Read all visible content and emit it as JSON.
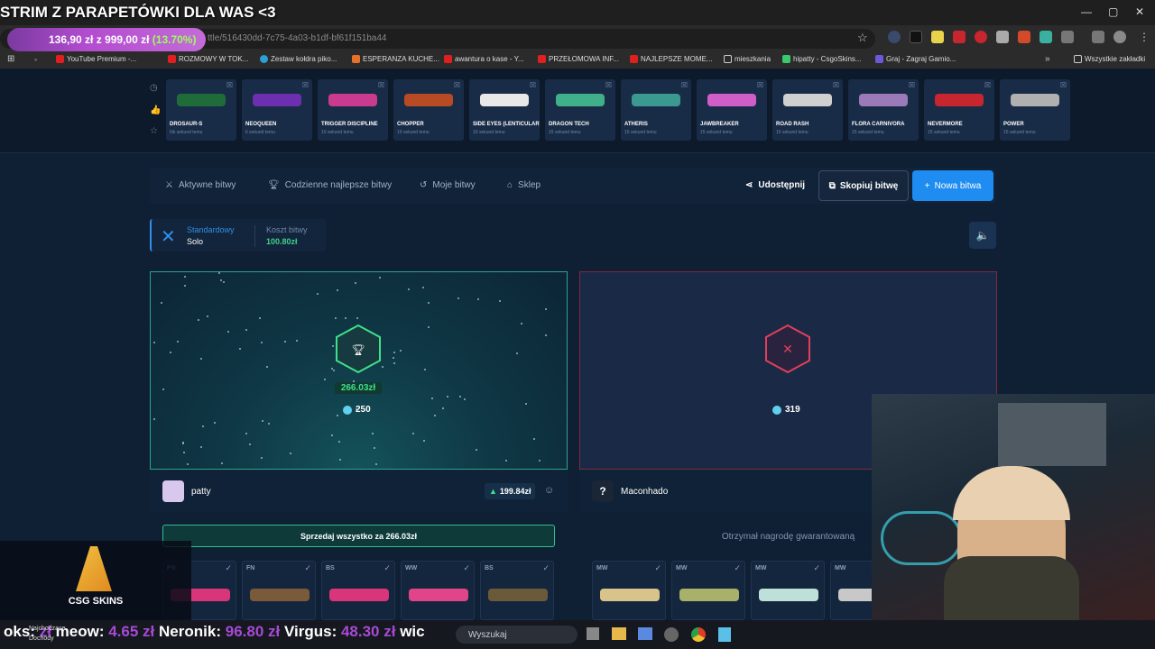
{
  "stream_title": "STRIM Z PARAPETÓWKI DLA WAS <3",
  "browser": {
    "price_main": "136,90 zł",
    "price_sep": "z",
    "price_goal": "999,00 zł",
    "price_pct": "(13.70%)",
    "url_fragment": "ttle/516430dd-7c75-4a03-b1df-bf61f151ba44",
    "bookmarks": [
      "YouTube Premium -...",
      "ROZMOWY W TOK...",
      "Zestaw kołdra piko...",
      "ESPERANZA KUCHE...",
      "awantura o kase - Y...",
      "PRZEŁOMOWA INF...",
      "NAJLEPSZE MOME...",
      "mieszkania",
      "hipatty - CsgoSkins...",
      "Graj - Zagraj Gamio..."
    ],
    "bookmarks_all": "Wszystkie zakładki"
  },
  "drops": [
    {
      "name": "DROSAUR-S",
      "sub": "6ik sekund temu",
      "color": "#1f6b3a"
    },
    {
      "name": "NEOQUEEN",
      "sub": "6 sekund temu",
      "color": "#6b2fb0"
    },
    {
      "name": "TRIGGER DISCIPLINE",
      "sub": "10 sekund temu",
      "color": "#c93b8f"
    },
    {
      "name": "CHOPPER",
      "sub": "10 sekund temu",
      "color": "#b84a24"
    },
    {
      "name": "SIDE EYES (LENTICULAR)",
      "sub": "10 sekund temu",
      "color": "#e8e8e8"
    },
    {
      "name": "DRAGON TECH",
      "sub": "15 sekund temu",
      "color": "#3fb08a"
    },
    {
      "name": "ATHERIS",
      "sub": "15 sekund temu",
      "color": "#3a9a8f"
    },
    {
      "name": "JAWBREAKER",
      "sub": "15 sekund temu",
      "color": "#cf5ec8"
    },
    {
      "name": "ROAD RASH",
      "sub": "15 sekund temu",
      "color": "#d0d0d0"
    },
    {
      "name": "FLORA CARNIVORA",
      "sub": "15 sekund temu",
      "color": "#9a7ab8"
    },
    {
      "name": "NEVERMORE",
      "sub": "15 sekund temu",
      "color": "#c8262e"
    },
    {
      "name": "POWER",
      "sub": "15 sekund temu",
      "color": "#b0b0b0"
    }
  ],
  "nav": {
    "active_battles": "Aktywne bitwy",
    "daily_best": "Codzienne najlepsze bitwy",
    "my_battles": "Moje bitwy",
    "shop": "Sklep",
    "share": "Udostępnij",
    "copy_battle": "Skopiuj bitwę",
    "new_battle": "Nowa bitwa"
  },
  "mode": {
    "type_label": "Standardowy",
    "type_value": "Solo",
    "cost_label": "Koszt bitwy",
    "cost_value": "100.80zł"
  },
  "left_player": {
    "win_amount": "266.03zł",
    "coins": "250",
    "name": "patty",
    "balance": "199.84zł",
    "sell_all": "Sprzedaj wszystko za 266.03zł",
    "items": [
      {
        "wear": "FN",
        "color": "#d8357a"
      },
      {
        "wear": "FN",
        "color": "#7a5a3a"
      },
      {
        "wear": "BS",
        "color": "#d8357a"
      },
      {
        "wear": "WW",
        "color": "#e0458a"
      },
      {
        "wear": "BS",
        "color": "#6a5a3a"
      }
    ]
  },
  "right_player": {
    "coins": "319",
    "name": "Maconhado",
    "guaranteed": "Otrzymał nagrodę gwarantowaną",
    "items": [
      {
        "wear": "MW",
        "color": "#d8c48a"
      },
      {
        "wear": "MW",
        "color": "#a8b06a"
      },
      {
        "wear": "MW",
        "color": "#bfe0d8"
      },
      {
        "wear": "MW",
        "color": "#c8c8c8"
      }
    ]
  },
  "overlay": {
    "logo": "CSG SKINS",
    "ticker": [
      {
        "name": "oks:",
        "value": ""
      },
      {
        "name": "",
        "value": "zł"
      },
      {
        "name": "meow:",
        "value": "4.65 zł"
      },
      {
        "name": "Neronik:",
        "value": "96.80 zł"
      },
      {
        "name": "Virgus:",
        "value": "48.30 zł"
      },
      {
        "name": "wic",
        "value": ""
      }
    ],
    "taskbar_search": "Wyszukaj",
    "taskbar_widget_top": "Najchodzące",
    "taskbar_widget_bottom": "Dochody"
  }
}
